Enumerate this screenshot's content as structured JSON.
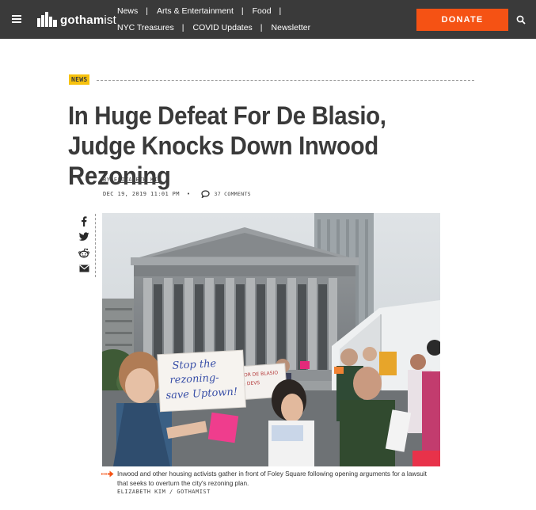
{
  "site": {
    "brand": "gotham",
    "brand_tail": "ist"
  },
  "nav": {
    "items": [
      "News",
      "Arts & Entertainment",
      "Food",
      "NYC Treasures",
      "COVID Updates",
      "Newsletter"
    ],
    "donate_label": "DONATE"
  },
  "article": {
    "category": "NEWS",
    "headline": "In Huge Defeat For De Blasio, Judge Knocks Down Inwood Rezoning",
    "byline_prefix": "BY",
    "author": "ELIZABETH KIM",
    "date": "DEC 19, 2019 11:01 PM",
    "comments": "37 COMMENTS"
  },
  "photo": {
    "signs": {
      "main": [
        "Stop the",
        "rezoning-",
        "save Uptown!"
      ],
      "back": [
        "FOR DE BLASIO",
        "& DEVS"
      ]
    },
    "caption": "Inwood and other housing activists gather in front of Foley Square following opening arguments for a lawsuit that seeks to overturn the city's rezoning plan.",
    "credit": "ELIZABETH KIM / GOTHAMIST"
  },
  "icons": {
    "menu": "hamburger-icon",
    "search": "search-icon",
    "comment": "comment-bubble-icon",
    "share": [
      "facebook-icon",
      "twitter-icon",
      "reddit-icon",
      "email-icon"
    ],
    "caption_arrow": "arrow-right-icon"
  },
  "colors": {
    "topbar": "#3a3a3a",
    "accent": "#f55214",
    "category": "#f7c20e"
  }
}
